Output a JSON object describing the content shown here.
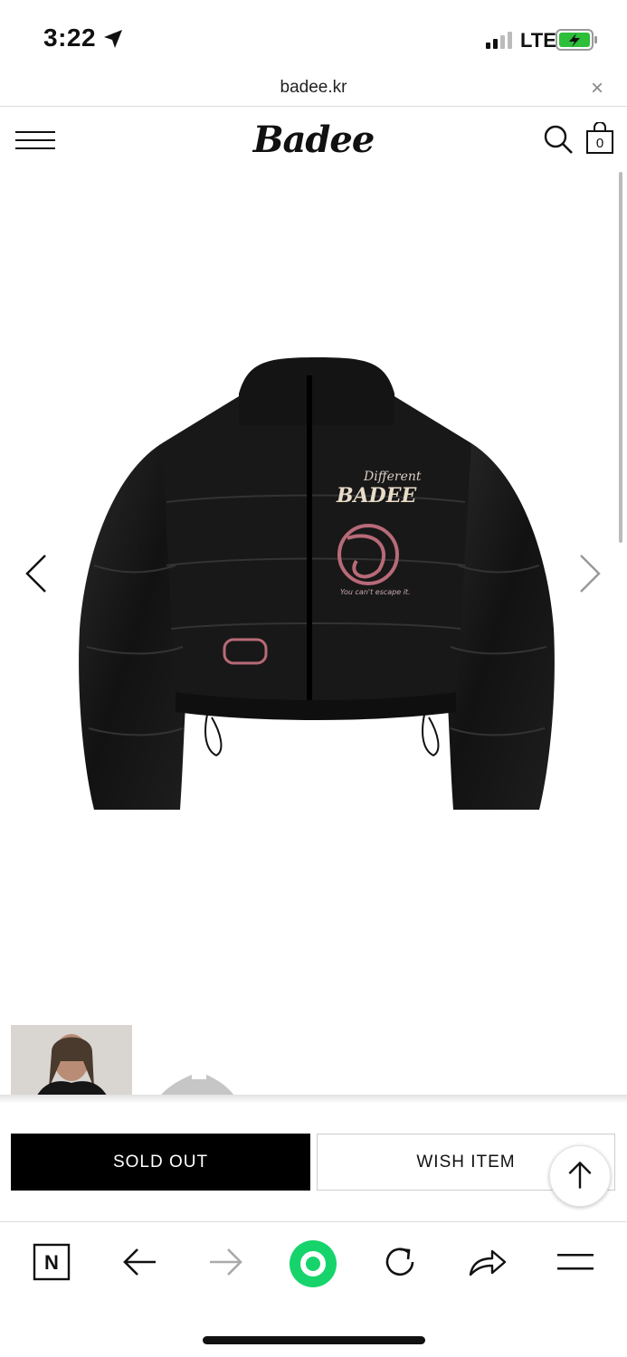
{
  "status_bar": {
    "time": "3:22",
    "network": "LTE",
    "icons": [
      "location-arrow-icon",
      "signal-icon",
      "battery-charging-icon"
    ],
    "battery_color": "#2dbe3a"
  },
  "browser": {
    "url": "badee.kr",
    "close_glyph": "×"
  },
  "site": {
    "logo": "Badee",
    "cart_count": "0",
    "icons": [
      "hamburger-menu-icon",
      "search-icon",
      "shopping-bag-icon"
    ]
  },
  "product": {
    "patch_top_small": "Different",
    "patch_top_big": "BADEE",
    "patch_script": "You can't escape it.",
    "gallery_icons": [
      "chevron-left-icon",
      "chevron-right-icon"
    ]
  },
  "actions": {
    "sold_out": "SOLD OUT",
    "wish": "WISH ITEM"
  },
  "toolbar": {
    "n_label": "N",
    "icons": [
      "naver-n-icon",
      "back-arrow-icon",
      "forward-arrow-icon",
      "green-home-icon",
      "reload-icon",
      "share-icon",
      "menu-icon"
    ],
    "accent": "#16d46b"
  }
}
